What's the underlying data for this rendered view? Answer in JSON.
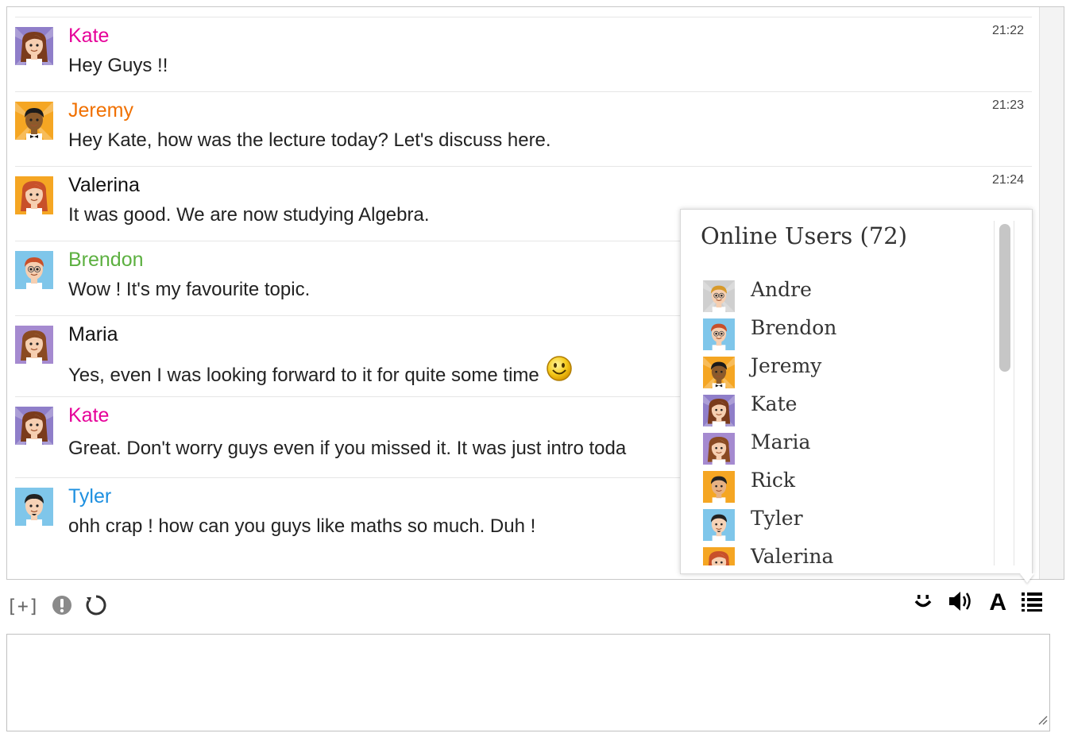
{
  "messages": [
    {
      "name": "Kate",
      "name_color": "#e60099",
      "text": "Hey Guys !!",
      "time": "21:22",
      "avatar": "kate"
    },
    {
      "name": "Jeremy",
      "name_color": "#f07000",
      "text": "Hey Kate, how was the lecture today? Let's discuss here.",
      "time": "21:23",
      "avatar": "jeremy"
    },
    {
      "name": "Valerina",
      "name_color": "#111111",
      "text": "It was good. We are now studying Algebra.",
      "time": "21:24",
      "avatar": "valerina"
    },
    {
      "name": "Brendon",
      "name_color": "#5cb040",
      "text": "Wow ! It's my favourite topic.",
      "time": "",
      "avatar": "brendon"
    },
    {
      "name": "Maria",
      "name_color": "#111111",
      "text": "Yes, even I was looking forward to it for quite some time",
      "time": "",
      "avatar": "maria",
      "emoticon": "smiley-icon"
    },
    {
      "name": "Kate",
      "name_color": "#e60099",
      "text": "Great. Don't worry guys even if you missed it. It was just intro toda",
      "time": "",
      "avatar": "kate"
    },
    {
      "name": "Tyler",
      "name_color": "#1e90e0",
      "text": "ohh crap ! how can you guys like maths so much. Duh !",
      "time": "",
      "avatar": "tyler"
    }
  ],
  "online_users": {
    "title": "Online Users (72)",
    "users": [
      {
        "name": "Andre",
        "avatar": "andre"
      },
      {
        "name": "Brendon",
        "avatar": "brendon"
      },
      {
        "name": "Jeremy",
        "avatar": "jeremy"
      },
      {
        "name": "Kate",
        "avatar": "kate"
      },
      {
        "name": "Maria",
        "avatar": "maria"
      },
      {
        "name": "Rick",
        "avatar": "rick"
      },
      {
        "name": "Tyler",
        "avatar": "tyler"
      },
      {
        "name": "Valerina",
        "avatar": "valerina"
      }
    ]
  },
  "toolbar": {
    "expand_label": "[+]",
    "left_icons": [
      "info-icon",
      "refresh-icon"
    ],
    "right_icons": [
      "emoticon-icon",
      "sound-icon",
      "font-icon",
      "user-list-icon"
    ],
    "font_label": "A"
  },
  "input": {
    "value": "",
    "placeholder": ""
  }
}
